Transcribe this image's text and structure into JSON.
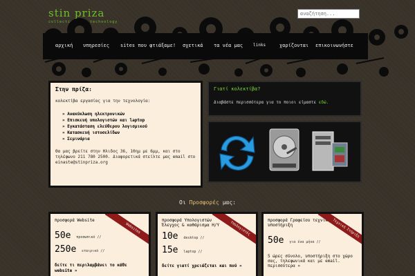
{
  "header": {
    "logo_title": "stin priza",
    "logo_subtitle": "collective for technology",
    "search_placeholder": "αναζήτηση..."
  },
  "nav": {
    "items": [
      {
        "label": "αρχική"
      },
      {
        "label": "υπηρεσίες"
      },
      {
        "label": "sites που φτιάξαμε!"
      },
      {
        "label": "σχετικά"
      },
      {
        "label": "τα νέα μας"
      },
      {
        "label": "links"
      },
      {
        "label": "χαρίζονται"
      },
      {
        "label": "επικοινωνήστε"
      }
    ]
  },
  "intro": {
    "title": "Στην πρίζα:",
    "subtitle": "κολεκτίβα εργασίας για την τεχνολογία:",
    "services": [
      "Ανακύκλωση ηλεκτρονικών",
      "Επισκευή υπολογιστών και laptop",
      "Εγκατάσταση ελεύθερου λογισμικού",
      "Κατασκευή ιστοσελίδων",
      "Σεμινάρια"
    ],
    "contact": "Θα μας βρείτε στην Ηλιδος 36, 10ημ με 6μμ, και στο τηλέφωνο 211 780 2500. Διαφορετικά στείλτε μας email στο einaste@stinpriza.org"
  },
  "why": {
    "title": "Γιατί κολεκτίβα?",
    "text": "Διαβάστε περισσότερα για το ποιοι είμαστε",
    "link": "εδώ."
  },
  "icons": [
    {
      "name": "recycle-arrows-icon"
    },
    {
      "name": "hard-drive-icon"
    },
    {
      "name": "computer-tower-icon"
    }
  ],
  "offers_section": {
    "prefix": "Οι",
    "emphasis": "Προσφορές",
    "suffix": "μας:"
  },
  "offers": [
    {
      "title": "προσφορά Website",
      "ribbon": "Websites",
      "prices": [
        {
          "amount": "50e",
          "label": "προσωπικό //"
        },
        {
          "amount": "250e",
          "label": "εταιρικό //"
        }
      ],
      "more": "δείτε τι περιλαμβάνει το κάθε website »"
    },
    {
      "title": "προσφορά Υπολογιστών Έλεγχος & καθάρισμα Η/Υ",
      "ribbon": "Υπολογιστές",
      "prices": [
        {
          "amount": "10e",
          "label": "desktop //"
        },
        {
          "amount": "15e",
          "label": "laptop //"
        }
      ],
      "more": "δείτε γιατί χρειάζεται και πού »"
    },
    {
      "title": "προσφορά Γραφείου τεχνική υποστήριξη",
      "ribbon": "Τεχνική Στήριξη",
      "prices": [
        {
          "amount": "50e",
          "label": "για ένα μήνα //"
        }
      ],
      "desc": "5 ώρες σύνολο, υποστήριξη στο χώρο σας, τηλεφωνικά και με email. περισσότερα »"
    }
  ],
  "colors": {
    "background": "#3b342b",
    "accent_green": "#6fbf2a",
    "ribbon_red": "#8e1a1a",
    "panel_cream": "#fbeedd"
  }
}
